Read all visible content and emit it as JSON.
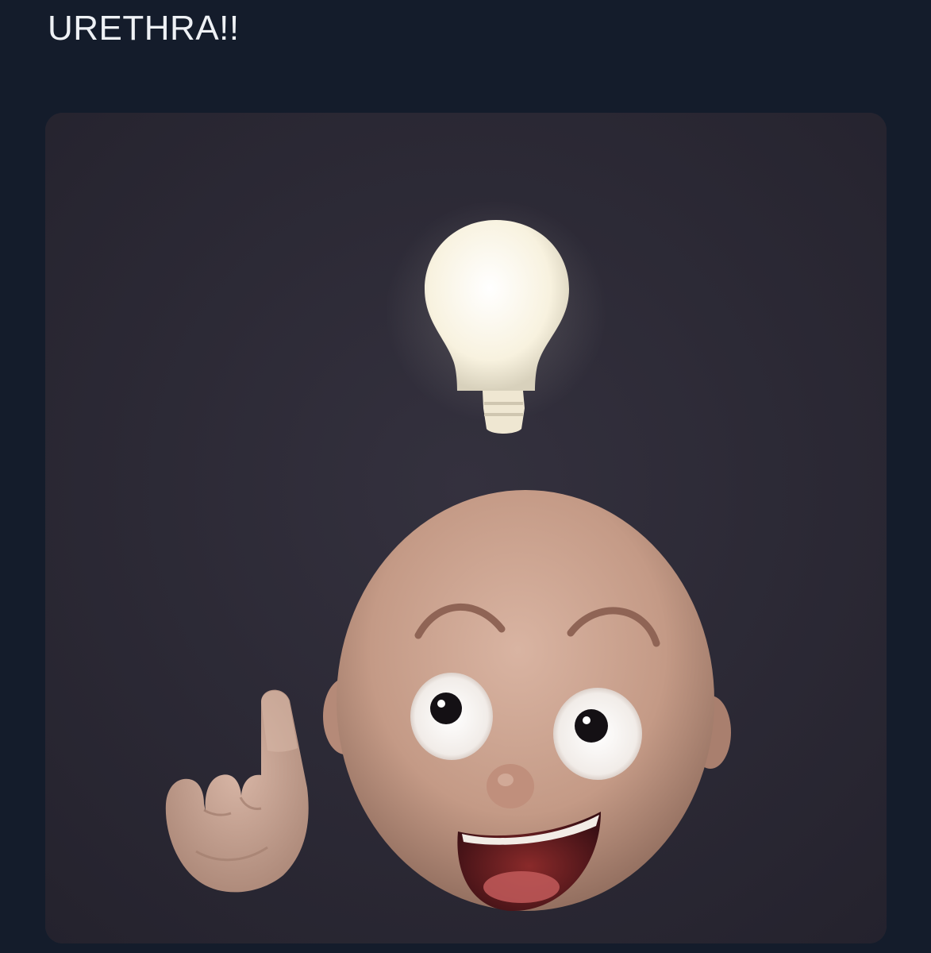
{
  "post": {
    "text": "URETHRA!!"
  },
  "media": {
    "kind": "image",
    "subject_icons": [
      "lightbulb-icon",
      "bald-cartoon-face",
      "pointing-finger-hand"
    ]
  },
  "colors": {
    "page_background": "#141c2b",
    "text": "#eef1f5",
    "image_background": "#2c2a36",
    "skin": "#c9a08d",
    "bulb_glow": "#fbf6e6"
  }
}
